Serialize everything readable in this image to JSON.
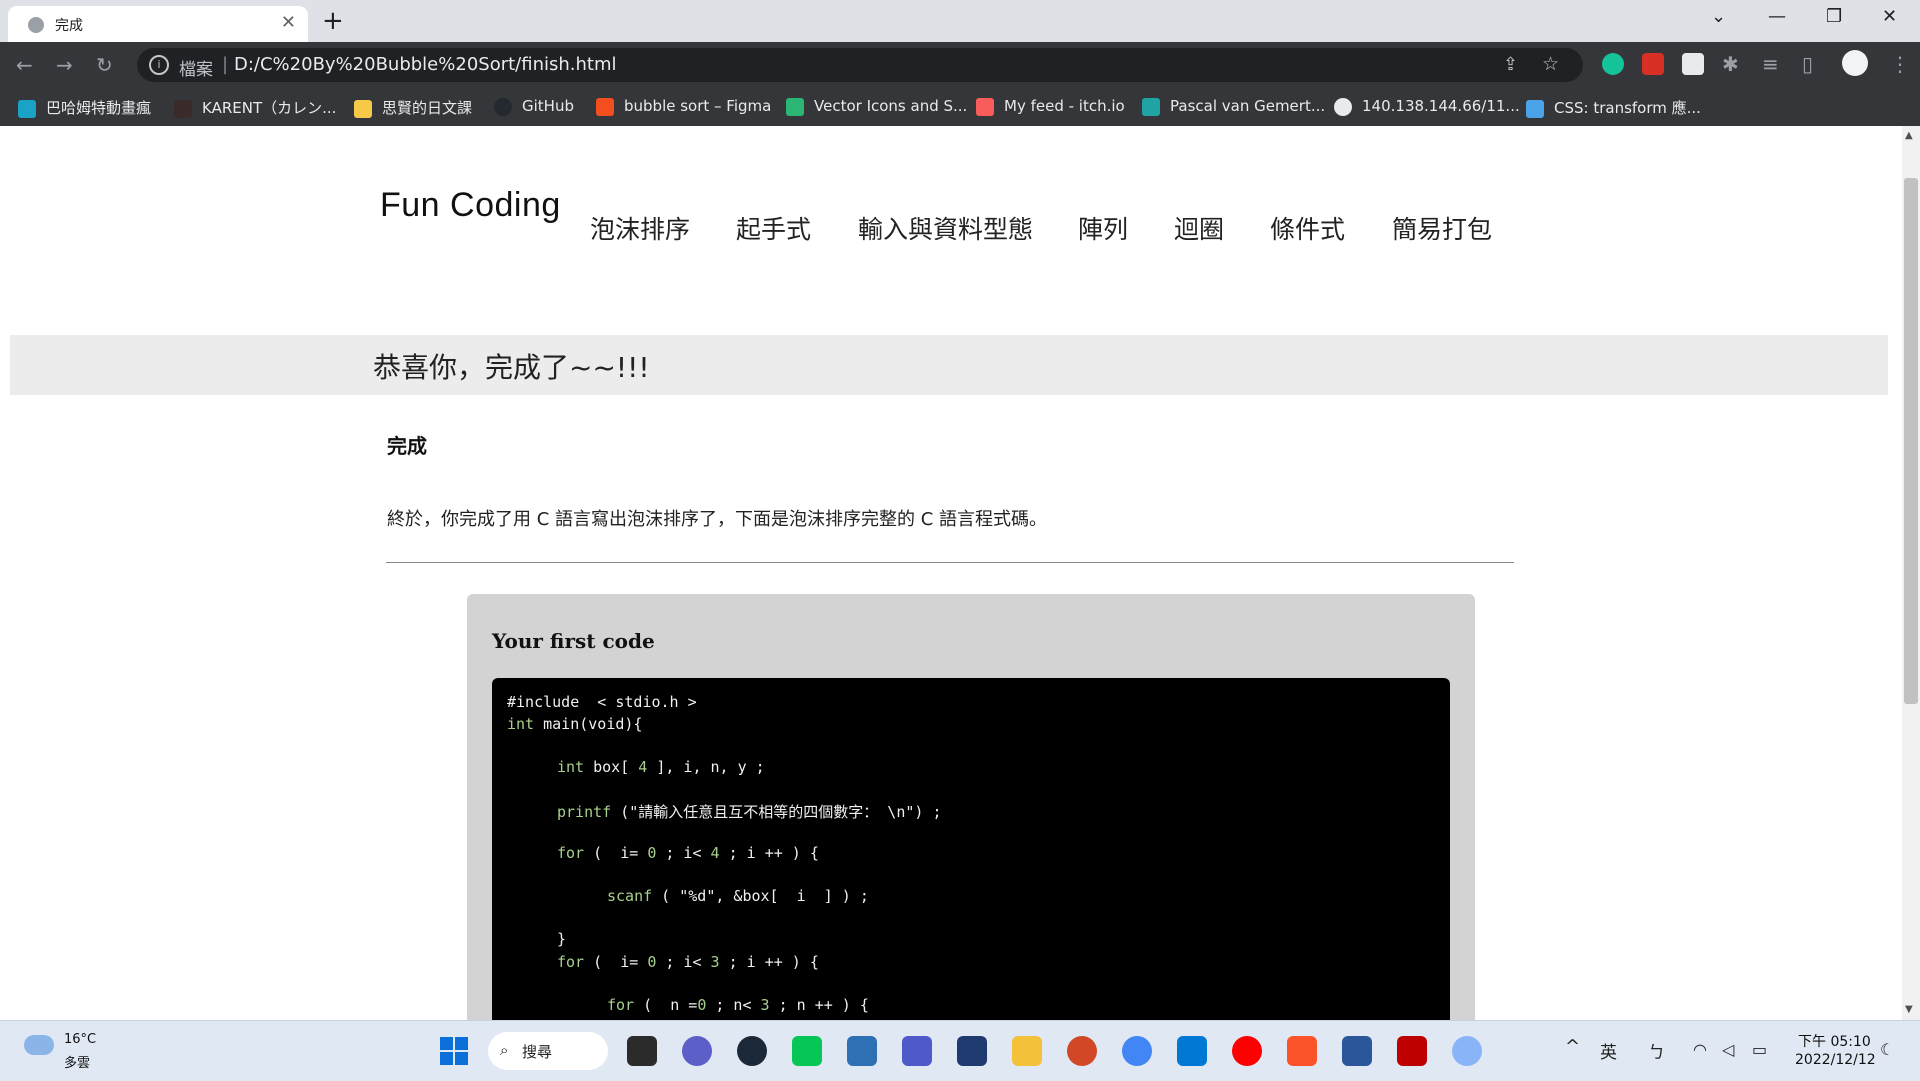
{
  "browser": {
    "tab_title": "完成",
    "url_scheme": "檔案",
    "url": "D:/C%20By%20Bubble%20Sort/finish.html",
    "bookmarks": [
      "巴哈姆特動畫瘋",
      "KARENT（カレン...",
      "思賢的日文課",
      "GitHub",
      "bubble sort – Figma",
      "Vector Icons and S...",
      "My feed - itch.io",
      "Pascal van Gemert...",
      "140.138.144.66/11...",
      "CSS: transform 應..."
    ]
  },
  "site": {
    "logo": "Fun Coding",
    "nav": [
      "泡沫排序",
      "起手式",
      "輸入與資料型態",
      "陣列",
      "迴圈",
      "條件式",
      "簡易打包"
    ]
  },
  "page": {
    "banner": "恭喜你，完成了~~!!!",
    "section_title": "完成",
    "intro": "終於，你完成了用 C 語言寫出泡沫排序了，下面是泡沫排序完整的 C 語言程式碼。",
    "code_card_title": "Your first code"
  },
  "code": {
    "l1": "#include  < stdio.h >",
    "l2_kw": "int",
    "l2": " main(void){",
    "l3_kw": "int",
    "l3a": " box[ ",
    "l3_num": "4",
    "l3b": " ], i, n, y ;",
    "l4_kw": "printf",
    "l4": " (\"請輸入任意且互不相等的四個數字： \\n\") ;",
    "l5_kw": "for",
    "l5a": " (  i= ",
    "l5_n1": "0",
    "l5b": " ; i< ",
    "l5_n2": "4",
    "l5c": " ; i ++ ) {",
    "l6_kw": "scanf",
    "l6": " ( \"%d\", &box[  i  ] ) ;",
    "l7": "}",
    "l8_kw": "for",
    "l8a": " (  i= ",
    "l8_n1": "0",
    "l8b": " ; i< ",
    "l8_n2": "3",
    "l8c": " ; i ++ ) {",
    "l9_kw": "for",
    "l9a": " (  n =",
    "l9_n1": "0",
    "l9b": " ; n< ",
    "l9_n2": "3",
    "l9c": " ; n ++ ) {"
  },
  "taskbar": {
    "weather_temp": "16°C",
    "weather_desc": "多雲",
    "search_label": "搜尋",
    "lang": "英",
    "ime": "ㄅ",
    "time": "下午 05:10",
    "date": "2022/12/12"
  }
}
